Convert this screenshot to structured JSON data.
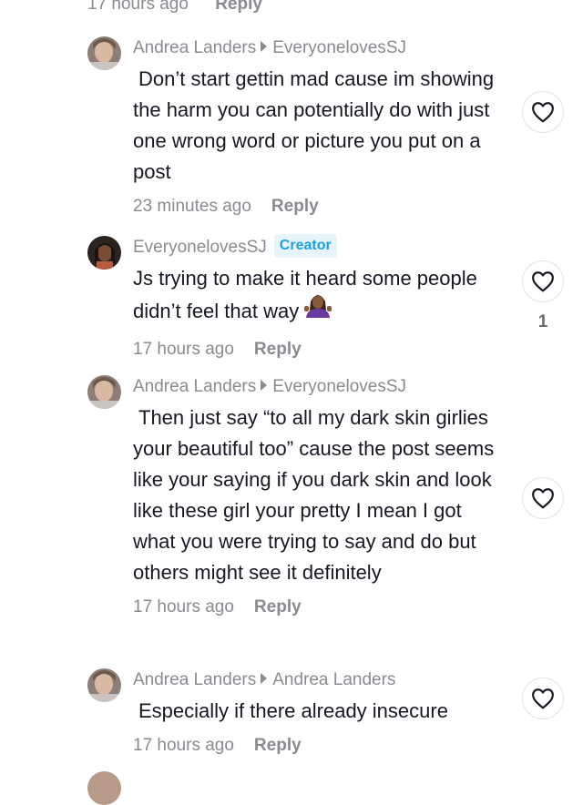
{
  "top_meta": {
    "time": "17 hours ago",
    "reply": "Reply"
  },
  "comments": [
    {
      "author": "Andrea Landers",
      "reply_to": "EveryonelovesSJ",
      "text": "Don’t start gettin mad cause im showing the harm you can potentially do with just one wrong word or picture you put on a post",
      "time": "23 minutes ago",
      "reply": "Reply"
    },
    {
      "author": "EveryonelovesSJ",
      "badge": "Creator",
      "text": "Js trying to make it heard some people didn’t feel that way",
      "time": "17 hours ago",
      "reply": "Reply",
      "likes": "1"
    },
    {
      "author": "Andrea Landers",
      "reply_to": "EveryonelovesSJ",
      "text": "Then just say “to all my dark skin girlies your beautiful too” cause the post seems like your saying if you dark skin and look like these girl your pretty I mean I got what you were trying to say and do but others might see it definitely",
      "time": "17 hours ago",
      "reply": "Reply"
    },
    {
      "author": "Andrea Landers",
      "reply_to": "Andrea Landers",
      "text": "Especially if there already insecure",
      "time": "17 hours ago",
      "reply": "Reply"
    }
  ],
  "icons": {
    "like": "heart-outline-icon",
    "reply_arrow": "caret-right-icon",
    "emoji": "person-shrugging-emoji"
  },
  "colors": {
    "muted": "#8a8b91",
    "text": "#161823",
    "creator_badge": "#1ea0e0",
    "creator_badge_bg": "#e6f4fb"
  }
}
